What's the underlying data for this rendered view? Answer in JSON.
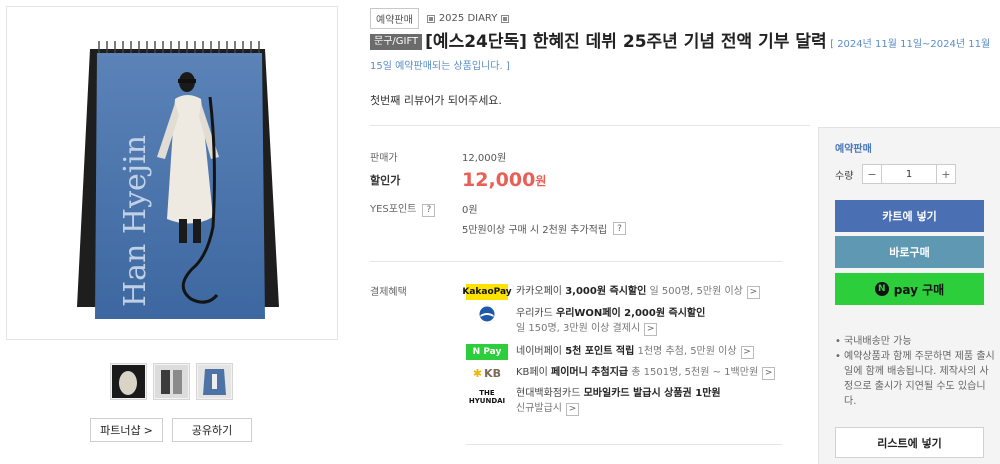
{
  "tags": {
    "preorder": "예약판매",
    "series": "2025 DIARY"
  },
  "title": {
    "category": "문구/GIFT",
    "text": "[예스24단독] 한혜진 데뷔 25주년 기념 전액 기부 달력",
    "note": "[ 2024년 11월 11일~2024년 11월 15일 예약판매되는 상품입니다. ]"
  },
  "first_review": "첫번째 리뷰어가 되어주세요.",
  "price": {
    "list_label": "판매가",
    "list_value": "12,000원",
    "sale_label": "할인가",
    "sale_value": "12,000",
    "sale_unit": "원",
    "points_label": "YES포인트",
    "points_value": "0원",
    "extra": "5만원이상 구매 시 2천원 추가적립",
    "help": "?"
  },
  "benefits": {
    "label": "결제혜택",
    "items": [
      {
        "logo": "KakaoPay",
        "title": "카카오페이",
        "strong": "3,000원 즉시할인",
        "sub": "일 500명, 5만원 이상"
      },
      {
        "logo": "woori",
        "title": "우리카드",
        "strong": "우리WON페이 2,000원 즉시할인",
        "sub": "일 150명, 3만원 이상 결제시"
      },
      {
        "logo": "N Pay",
        "title": "네이버페이",
        "strong": "5천 포인트 적립",
        "sub": "1천명 추첨, 5만원 이상"
      },
      {
        "logo": "KB",
        "title": "KB페이",
        "strong": "페이머니 추첨지급",
        "sub": "총 1501명, 5천원 ~ 1백만원"
      },
      {
        "logo": "THE HYUNDAI",
        "title": "현대백화점카드",
        "strong": "모바일카드 발급시 상품권 1만원",
        "sub": "신규발급시"
      }
    ],
    "arrow": ">"
  },
  "left_buttons": {
    "partner": "파트너샵",
    "share": "공유하기",
    "chevron": ">"
  },
  "cover_text": "Han Hyejin",
  "panel": {
    "preorder": "예약판매",
    "qty_label": "수량",
    "minus": "−",
    "qty": "1",
    "plus": "+",
    "cart": "카트에 넣기",
    "buy": "바로구매",
    "npay_mark": "N",
    "npay": "pay 구매",
    "notes": [
      "국내배송만 가능",
      "예약상품과 함께 주문하면 제품 출시일에 함께 배송됩니다. 제작사의 사정으로 출시가 지연될 수도 있습니다."
    ],
    "wishlist": "리스트에 넣기"
  },
  "colors": {
    "sale": "#e95f56",
    "cart": "#4a6fb3",
    "buy": "#5f98b3",
    "npay": "#2dce3c"
  }
}
